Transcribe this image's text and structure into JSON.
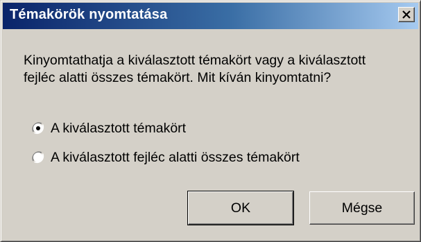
{
  "window": {
    "title": "Témakörök nyomtatása",
    "close_icon": "close-icon"
  },
  "message": {
    "line1": "Kinyomtathatja a kiválasztott témakört vagy a kiválasztott",
    "line2": "fejléc alatti összes témakört. Mit kíván kinyomtatni?"
  },
  "options": [
    {
      "label": "A kiválasztott témakört",
      "selected": true
    },
    {
      "label": "A kiválasztott fejléc alatti összes témakört",
      "selected": false
    }
  ],
  "buttons": {
    "ok_label": "OK",
    "cancel_label": "Mégse"
  }
}
